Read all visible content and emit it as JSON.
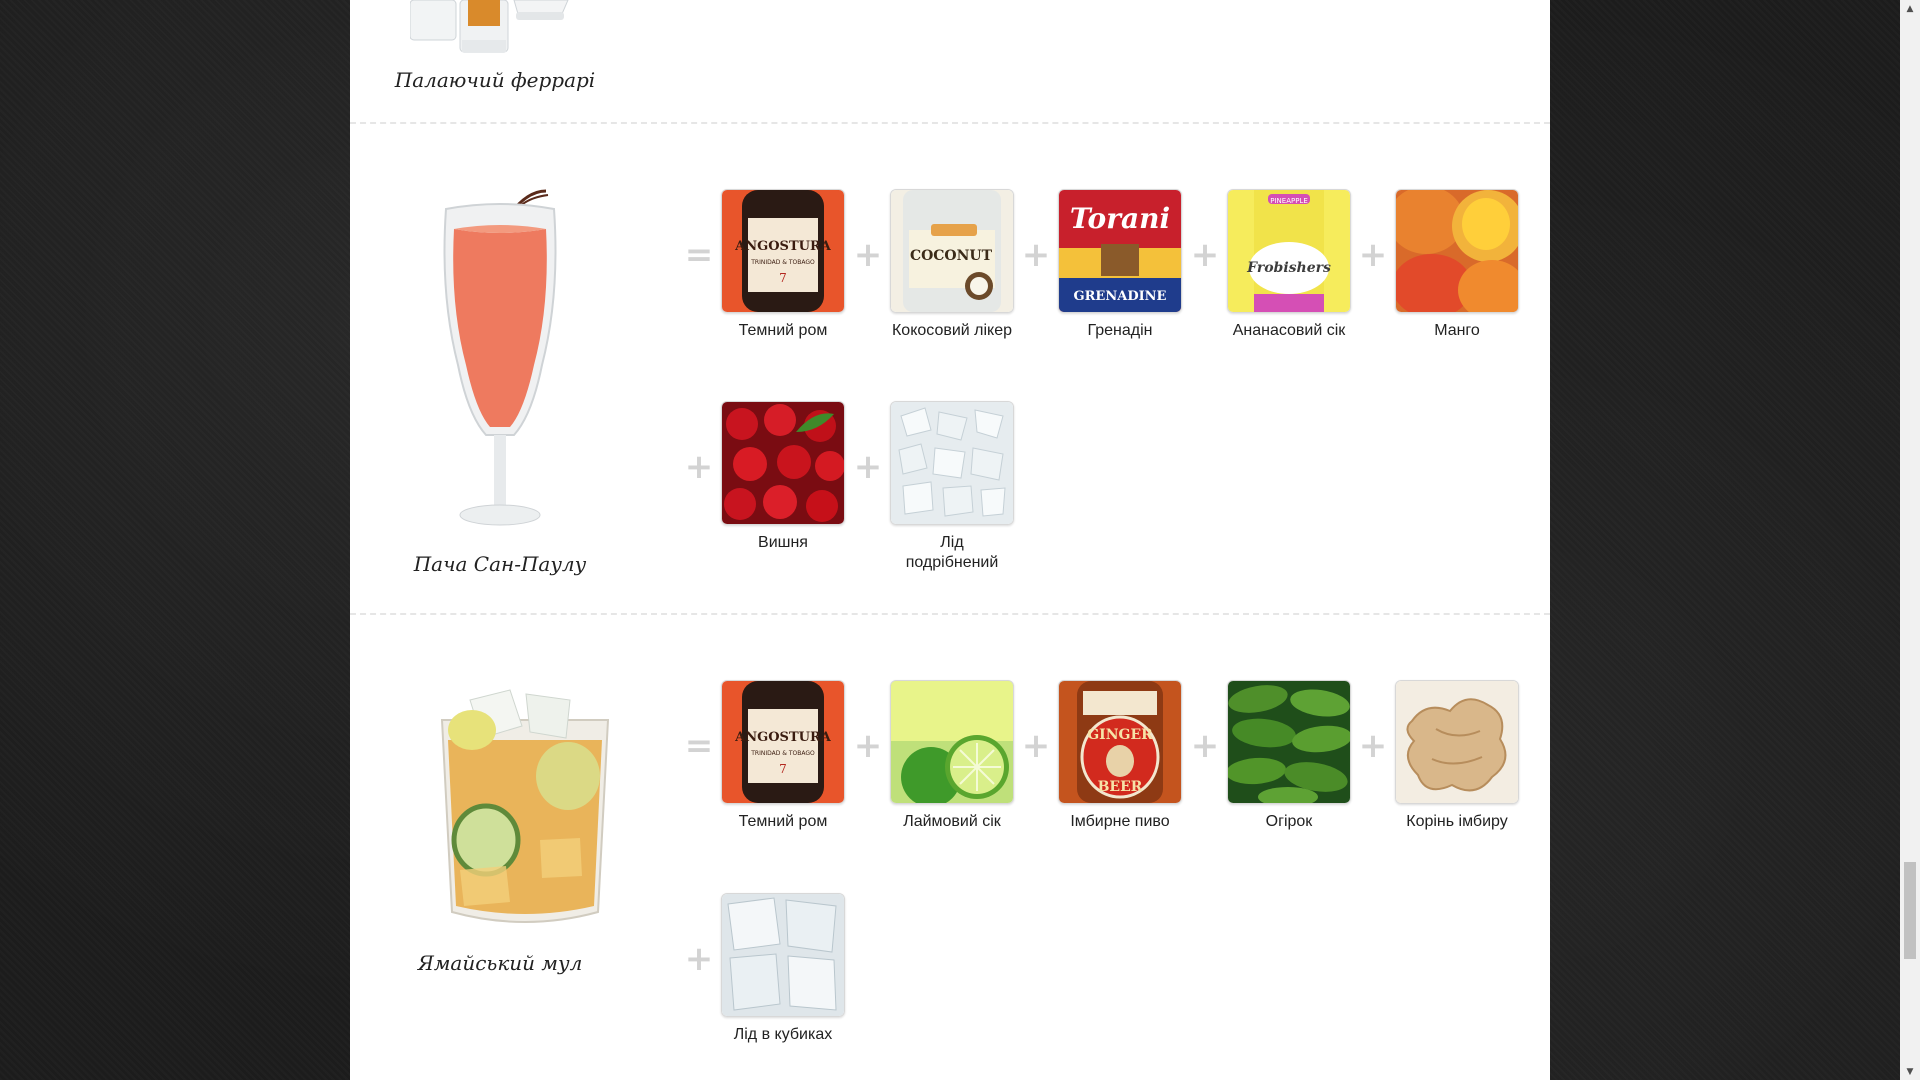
{
  "colors": {
    "page_bg": "#1d1d1d",
    "card_bg": "#ffffff",
    "operator": "#d3d3d3"
  },
  "cocktails": [
    {
      "name": "Палаючий феррарі"
    },
    {
      "name": "Пача Сан-Паулу",
      "ingredients": [
        {
          "label": "Темний ром",
          "icon": "angostura-bottle-icon"
        },
        {
          "label": "Кокосовий лікер",
          "icon": "coconut-liqueur-icon"
        },
        {
          "label": "Гренадін",
          "icon": "torani-grenadine-icon"
        },
        {
          "label": "Ананасовий сік",
          "icon": "pineapple-juice-icon"
        },
        {
          "label": "Манго",
          "icon": "mango-icon"
        },
        {
          "label": "Вишня",
          "icon": "cherries-icon"
        },
        {
          "label": "Лід подрібнений",
          "icon": "crushed-ice-icon"
        }
      ]
    },
    {
      "name": "Ямайський мул",
      "ingredients": [
        {
          "label": "Темний ром",
          "icon": "angostura-bottle-icon"
        },
        {
          "label": "Лаймовий сік",
          "icon": "lime-juice-icon"
        },
        {
          "label": "Імбирне пиво",
          "icon": "ginger-beer-icon"
        },
        {
          "label": "Огірок",
          "icon": "cucumbers-icon"
        },
        {
          "label": "Корінь імбиру",
          "icon": "ginger-root-icon"
        },
        {
          "label": "Лід в кубиках",
          "icon": "ice-cubes-icon"
        }
      ]
    }
  ],
  "operators": {
    "equals": "=",
    "plus": "+"
  },
  "product_text": {
    "angostura": "ANGOSTURA",
    "angostura_sub": "TRINIDAD & TOBAGO",
    "coconut": "COCONUT",
    "torani": "Torani",
    "grenadine": "GRENADINE",
    "pineapple": "PINEAPPLE",
    "frobishers": "Frobishers",
    "ginger": "GINGER",
    "beer": "BEER"
  }
}
